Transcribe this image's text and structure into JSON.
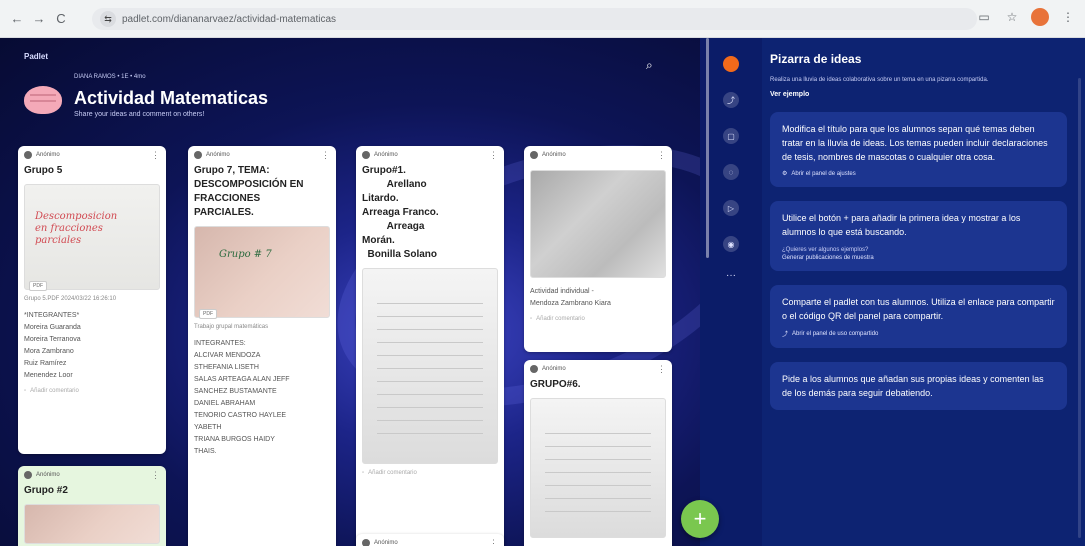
{
  "browser": {
    "url": "padlet.com/diananarvaez/actividad-matematicas",
    "nav_back": "←",
    "nav_forward": "→",
    "nav_reload": "C",
    "tune": "⇆",
    "icon_cast": "▭",
    "icon_star": "☆",
    "icon_menu": "⋮"
  },
  "board": {
    "brand": "Padlet",
    "meta": "DIANA RAMOS • 1E • 4mo",
    "title": "Actividad Matematicas",
    "subtitle": "Share your ideas and comment on others!",
    "search_icon": "⌕"
  },
  "cards": {
    "c1": {
      "author": "Anónimo",
      "title": "Grupo 5",
      "ink": "Descomposicion\nen fracciones\nparciales",
      "pdf": "PDF",
      "caption": "Grupo 5.PDF 2024/03/22 16:26:10",
      "body": "*INTEGRANTES*\nMoreira Guaranda\nMoreira Terranova\nMora Zambrano\nRuiz Ramírez\nMenendez Loor",
      "foot": "Añadir comentario"
    },
    "c2": {
      "author": "Anónimo",
      "title": "Grupo #2"
    },
    "c3": {
      "author": "Anónimo",
      "title": "Grupo 7, TEMA:\nDESCOMPOSICIÓN EN\nFRACCIONES\nPARCIALES.",
      "ink": "Grupo # 7",
      "pdf": "PDF",
      "caption": "Trabajo grupal matemáticas",
      "body": "INTEGRANTES:\nALCIVAR MENDOZA\nSTHEFANIA LISETH\nSALAS ARTEAGA ALAN JEFF\nSANCHEZ BUSTAMANTE\nDANIEL ABRAHAM\nTENORIO CASTRO HAYLEE\nYABETH\nTRIANA BURGOS HAIDY\nTHAIS."
    },
    "c4": {
      "author": "Anónimo",
      "title": "Grupo#1.\n         Arellano\nLitardo.\nArreaga Franco.\n         Arreaga\nMorán.\n  Bonilla Solano",
      "foot": "Añadir comentario"
    },
    "c5": {
      "author": "Anónimo",
      "title": ""
    },
    "c6": {
      "author": "Anónimo",
      "body": "Actividad individual -\nMendoza Zambrano Kiara",
      "foot": "Añadir comentario"
    },
    "c7": {
      "author": "Anónimo",
      "title": "GRUPO#6."
    }
  },
  "rail": {
    "more": "···",
    "fab": "+"
  },
  "panel": {
    "title": "Pizarra de ideas",
    "description": "Realiza una lluvia de ideas colaborativa sobre un tema en una pizarra compartida.",
    "example_link": "Ver ejemplo",
    "tips": [
      {
        "text": "Modifica el título para que los alumnos sepan qué temas deben tratar en la lluvia de ideas. Los temas pueden incluir declaraciones de tesis, nombres de mascotas o cualquier otra cosa.",
        "action": "Abrir el panel de ajustes"
      },
      {
        "text": "Utilice el botón + para añadir la primera idea y mostrar a los alumnos lo que está buscando.",
        "sub": "¿Quieres ver algunos ejemplos?",
        "action": "Generar publicaciones de muestra"
      },
      {
        "text": "Comparte el padlet con tus alumnos. Utiliza el enlace para compartir o el código QR del panel para compartir.",
        "action": "Abrir el panel de uso compartido"
      },
      {
        "text": "Pide a los alumnos que añadan sus propias ideas y comenten las de los demás para seguir debatiendo."
      }
    ]
  }
}
